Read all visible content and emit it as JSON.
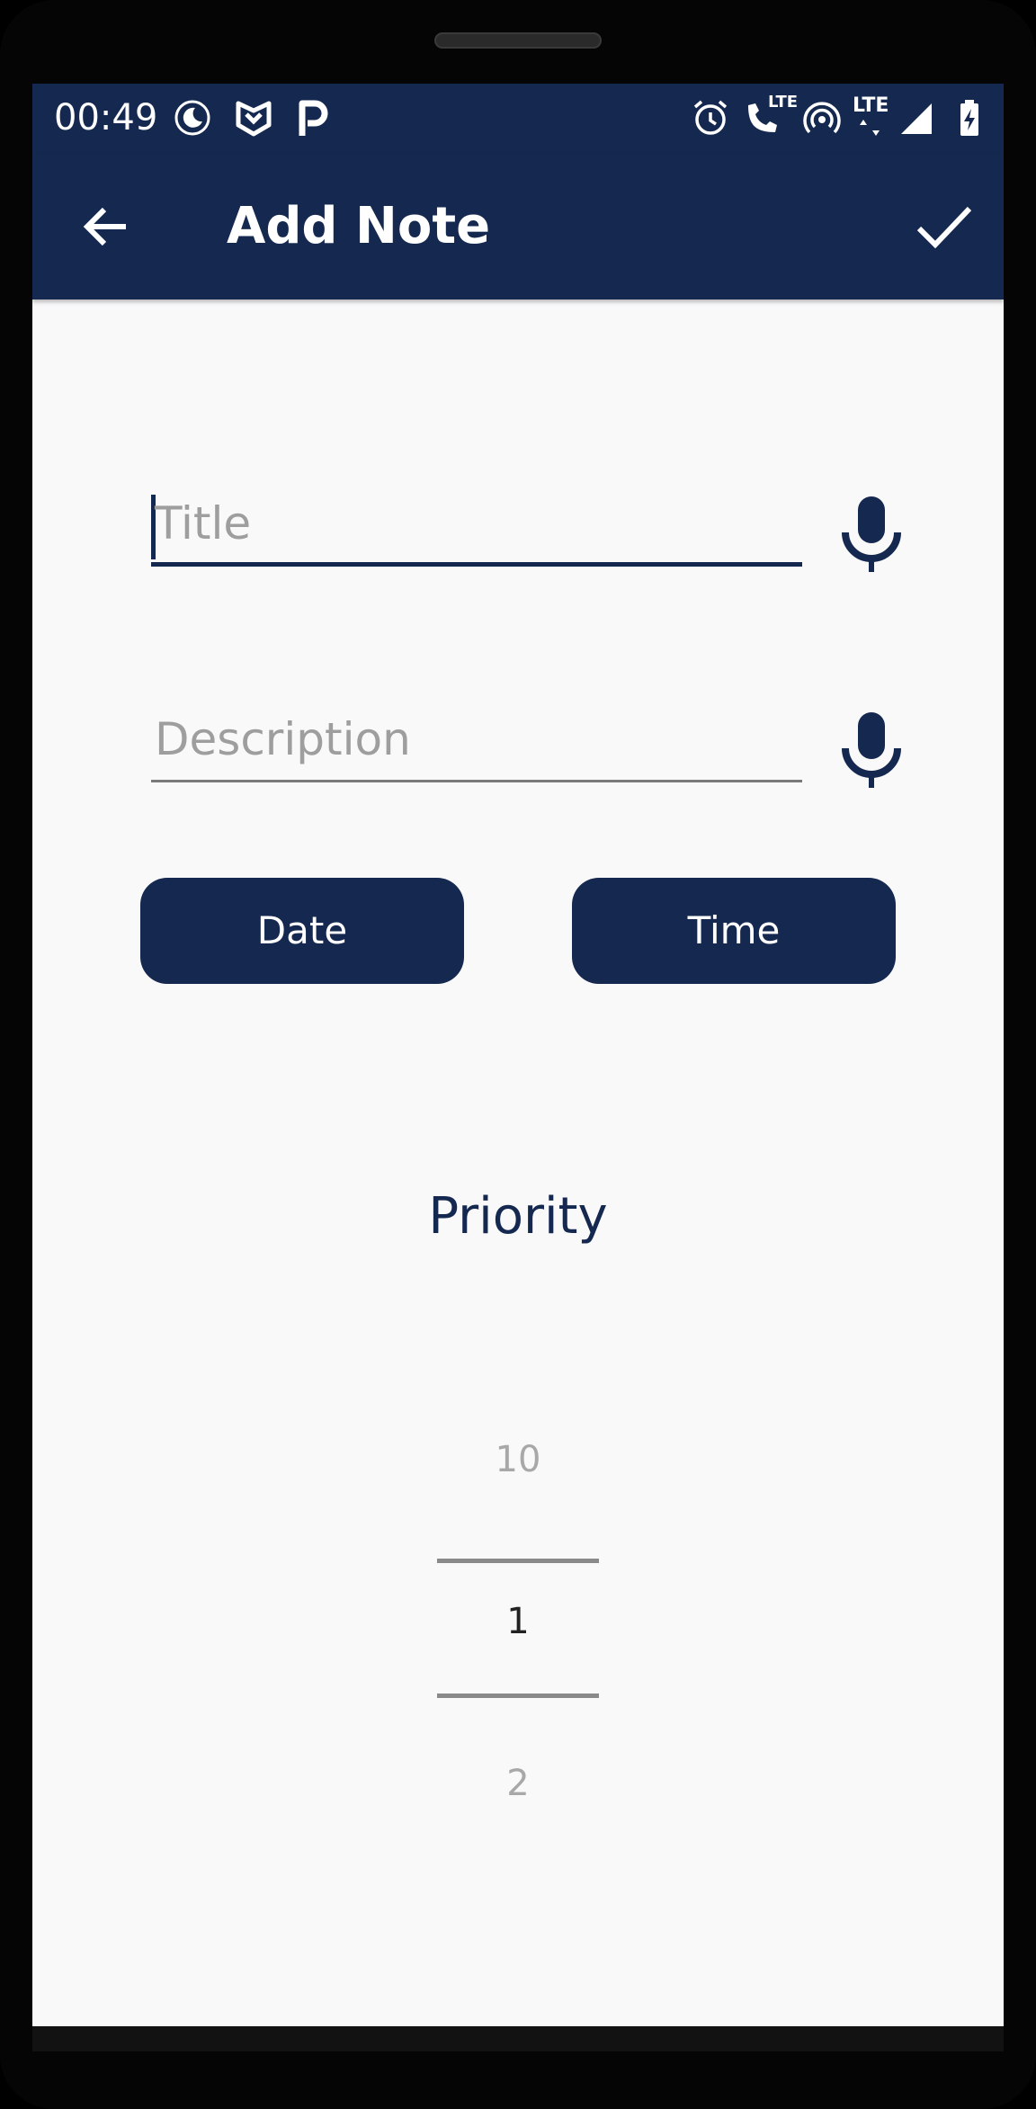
{
  "status_bar": {
    "time": "00:49",
    "left_icons": [
      "night-mode-icon",
      "shield-logo-icon",
      "p-app-icon"
    ],
    "right_icons": [
      "alarm-icon",
      "lte-call-icon",
      "hotspot-icon",
      "lte-data-icon",
      "signal-icon",
      "battery-charging-icon"
    ],
    "lte_label_1": "LTE",
    "lte_label_2": "LTE"
  },
  "app_bar": {
    "title": "Add Note",
    "back_icon": "arrow-left-icon",
    "confirm_icon": "check-icon"
  },
  "form": {
    "title_placeholder": "Title",
    "description_placeholder": "Description",
    "mic_icon": "microphone-icon",
    "date_button": "Date",
    "time_button": "Time"
  },
  "priority": {
    "label": "Priority",
    "previous_value": "10",
    "selected_value": "1",
    "next_value": "2"
  },
  "colors": {
    "primary": "#15284f",
    "background": "#f9f9fa",
    "hint_text": "#9e9e9e",
    "divider": "#8a8a8a"
  }
}
